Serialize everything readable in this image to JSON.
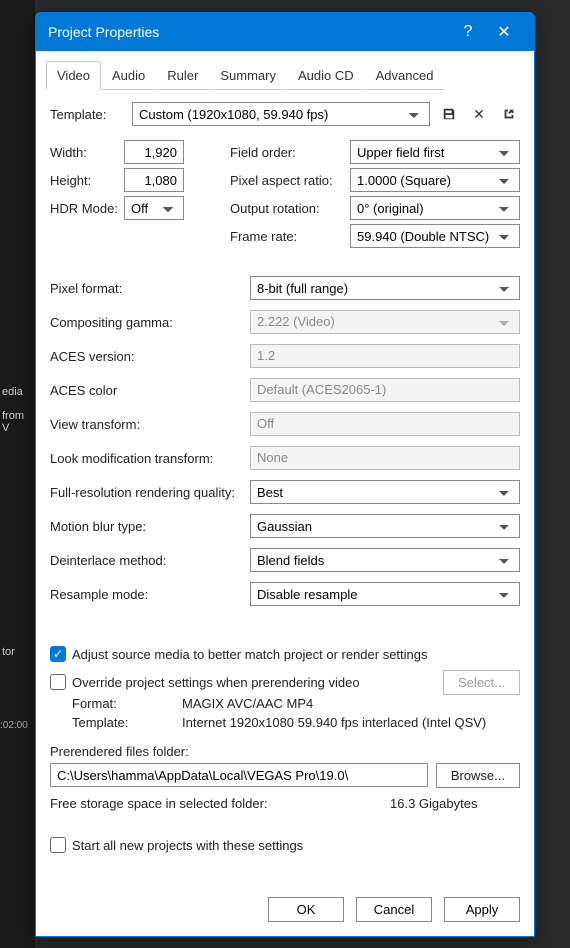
{
  "titlebar": {
    "title": "Project Properties"
  },
  "tabs": [
    "Video",
    "Audio",
    "Ruler",
    "Summary",
    "Audio CD",
    "Advanced"
  ],
  "activeTab": 0,
  "template": {
    "label": "Template:",
    "value": "Custom (1920x1080, 59.940 fps)"
  },
  "left": {
    "width": {
      "label": "Width:",
      "value": "1,920"
    },
    "height": {
      "label": "Height:",
      "value": "1,080"
    },
    "hdr": {
      "label": "HDR Mode:",
      "value": "Off"
    }
  },
  "right": {
    "fieldOrder": {
      "label": "Field order:",
      "value": "Upper field first"
    },
    "par": {
      "label": "Pixel aspect ratio:",
      "value": "1.0000 (Square)"
    },
    "rotation": {
      "label": "Output rotation:",
      "value": "0° (original)"
    },
    "frameRate": {
      "label": "Frame rate:",
      "value": "59.940 (Double NTSC)"
    }
  },
  "props": {
    "pixelFormat": {
      "label": "Pixel format:",
      "value": "8-bit (full range)"
    },
    "gamma": {
      "label": "Compositing gamma:",
      "value": "2.222 (Video)"
    },
    "acesVer": {
      "label": "ACES version:",
      "value": "1.2"
    },
    "acesColor": {
      "label": "ACES color",
      "value": "Default (ACES2065-1)"
    },
    "viewTransform": {
      "label": "View transform:",
      "value": "Off"
    },
    "lookMod": {
      "label": "Look modification transform:",
      "value": "None"
    },
    "renderQuality": {
      "label": "Full-resolution rendering quality:",
      "value": "Best"
    },
    "motionBlur": {
      "label": "Motion blur type:",
      "value": "Gaussian"
    },
    "deinterlace": {
      "label": "Deinterlace method:",
      "value": "Blend fields"
    },
    "resample": {
      "label": "Resample mode:",
      "value": "Disable resample"
    }
  },
  "adjustSource": {
    "label": "Adjust source media to better match project or render settings",
    "checked": true
  },
  "override": {
    "label": "Override project settings when prerendering video",
    "checked": false,
    "selectBtn": "Select..."
  },
  "prerender": {
    "formatLabel": "Format:",
    "formatValue": "MAGIX AVC/AAC MP4",
    "templateLabel": "Template:",
    "templateValue": "Internet 1920x1080 59.940 fps interlaced (Intel QSV)",
    "folderLabel": "Prerendered files folder:",
    "folderValue": "C:\\Users\\hamma\\AppData\\Local\\VEGAS Pro\\19.0\\",
    "browse": "Browse...",
    "freeSpaceLabel": "Free storage space in selected folder:",
    "freeSpaceValue": "16.3 Gigabytes"
  },
  "startAll": {
    "label": "Start all new projects with these settings",
    "checked": false
  },
  "buttons": {
    "ok": "OK",
    "cancel": "Cancel",
    "apply": "Apply"
  },
  "bg": {
    "media": "edia",
    "from": "from V",
    "tor": "tor",
    "time": ":02:00"
  }
}
